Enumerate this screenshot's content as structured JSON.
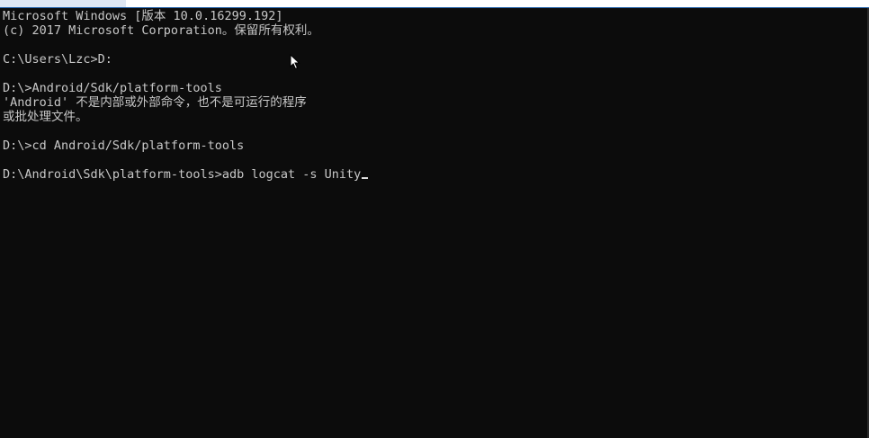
{
  "console": {
    "lines": [
      "Microsoft Windows [版本 10.0.16299.192]",
      "(c) 2017 Microsoft Corporation。保留所有权利。",
      "",
      "C:\\Users\\Lzc>D:",
      "",
      "D:\\>Android/Sdk/platform-tools",
      "'Android' 不是内部或外部命令，也不是可运行的程序",
      "或批处理文件。",
      "",
      "D:\\>cd Android/Sdk/platform-tools",
      "",
      "D:\\Android\\Sdk\\platform-tools>adb logcat -s Unity"
    ]
  }
}
